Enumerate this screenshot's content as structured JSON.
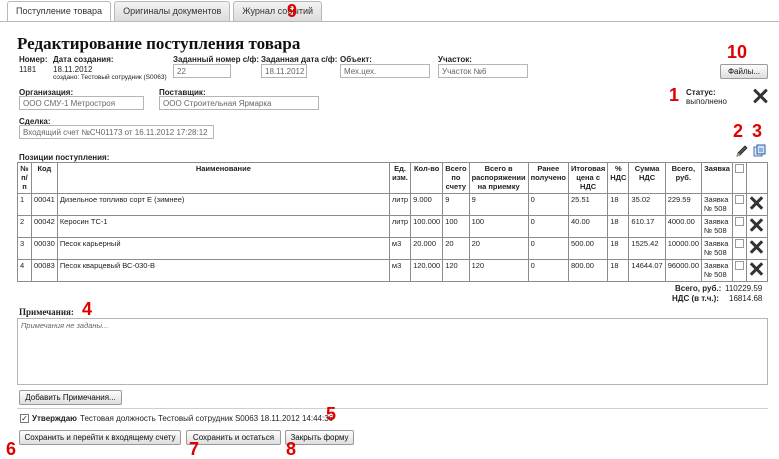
{
  "tabs": [
    {
      "label": "Поступление товара",
      "active": true
    },
    {
      "label": "Оригиналы документов",
      "active": false
    },
    {
      "label": "Журнал событий",
      "active": false
    }
  ],
  "markers": {
    "m1": "1",
    "m2": "2",
    "m3": "3",
    "m4": "4",
    "m5": "5",
    "m6": "6",
    "m7": "7",
    "m8": "8",
    "m9": "9",
    "m10": "10"
  },
  "page_title": "Редактирование поступления товара",
  "header": {
    "number_label": "Номер:",
    "number_value": "1181",
    "created_label": "Дата создания:",
    "created_value": "18.11.2012",
    "created_by": "создано: Тестовый сотрудник (S0063)",
    "sf_number_label": "Заданный номер с/ф:",
    "sf_number_value": "22",
    "sf_date_label": "Заданная дата с/ф:",
    "sf_date_value": "18.11.2012",
    "object_label": "Объект:",
    "object_value": "Мех.цех.",
    "site_label": "Участок:",
    "site_value": "Участок №6",
    "org_label": "Организация:",
    "org_value": "ООО СМУ-1 Метростроя",
    "supplier_label": "Поставщик:",
    "supplier_value": "ООО Строительная Ярмарка",
    "deal_label": "Сделка:",
    "deal_value": "Входящий счет №СЧ01173 от 16.11.2012 17:28:12",
    "status_label": "Статус:",
    "status_value": "выполнено",
    "files_button": "Файлы..."
  },
  "items_title": "Позиции поступления:",
  "columns": [
    "№ п/п",
    "Код",
    "Наименование",
    "Ед. изм.",
    "Кол-во",
    "Всего по счету",
    "Всего в распоряжении на приемку",
    "Ранее получено",
    "Итоговая цена с НДС",
    "% НДС",
    "Сумма НДС",
    "Всего, руб.",
    "Заявка"
  ],
  "rows": [
    {
      "n": "1",
      "code": "00041",
      "name": "Дизельное топливо сорт Е (зимнее)",
      "unit": "литр",
      "qty": "9.000",
      "invoice": "9",
      "available": "9",
      "received": "0",
      "price": "25.51",
      "vat_pct": "18",
      "vat_sum": "35.02",
      "total": "229.59",
      "request": "Заявка № 508"
    },
    {
      "n": "2",
      "code": "00042",
      "name": "Керосин ТС-1",
      "unit": "литр",
      "qty": "100.000",
      "invoice": "100",
      "available": "100",
      "received": "0",
      "price": "40.00",
      "vat_pct": "18",
      "vat_sum": "610.17",
      "total": "4000.00",
      "request": "Заявка № 508"
    },
    {
      "n": "3",
      "code": "00030",
      "name": "Песок карьерный",
      "unit": "м3",
      "qty": "20.000",
      "invoice": "20",
      "available": "20",
      "received": "0",
      "price": "500.00",
      "vat_pct": "18",
      "vat_sum": "1525.42",
      "total": "10000.00",
      "request": "Заявка № 508"
    },
    {
      "n": "4",
      "code": "00083",
      "name": "Песок кварцевый ВС-030-В",
      "unit": "м3",
      "qty": "120.000",
      "invoice": "120",
      "available": "120",
      "received": "0",
      "price": "800.00",
      "vat_pct": "18",
      "vat_sum": "14644.07",
      "total": "96000.00",
      "request": "Заявка № 508"
    }
  ],
  "totals": {
    "total_label": "Всего, руб.:",
    "total_value": "110229.59",
    "vat_label": "НДС (в т.ч.):",
    "vat_value": "16814.68"
  },
  "notes": {
    "label": "Примечания:",
    "placeholder": "Примечания не заданы...",
    "add_button": "Добавить Примечания..."
  },
  "approve": {
    "label": "Утверждаю",
    "text": "Тестовая должность Тестовый сотрудник S0063 18.11.2012 14:44:36",
    "checked": true
  },
  "buttons": {
    "save_go": "Сохранить и перейти к входящему счету",
    "save_stay": "Сохранить и остаться",
    "close": "Закрыть форму"
  },
  "icons": {
    "delete": "close-x-icon",
    "edit": "pencil-icon",
    "copy": "copy-icon"
  },
  "colors": {
    "marker": "#e00000"
  }
}
